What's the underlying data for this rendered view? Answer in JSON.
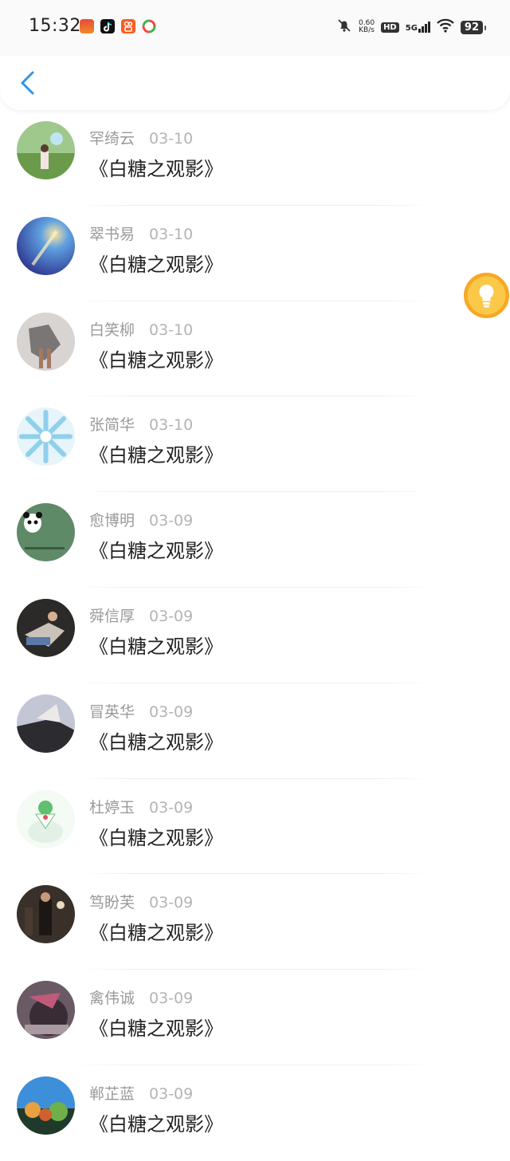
{
  "status_bar": {
    "time": "15:32",
    "net_speed_value": "0.60",
    "net_speed_unit": "KB/s",
    "hd_label": "HD",
    "network_type": "5G",
    "battery": "92",
    "icons": [
      "bell-muted-icon",
      "hd-icon",
      "signal-5g-icon",
      "wifi-icon",
      "battery-icon"
    ],
    "app_icons": [
      "sohu-video-app-icon",
      "douyin-app-icon",
      "kuaishou-app-icon",
      "pinwheel-app-icon"
    ]
  },
  "header": {
    "back_icon": "chevron-left-icon",
    "accent_color": "#2e96e8"
  },
  "list": [
    {
      "name": "罕绮云",
      "date": "03-10",
      "title": "《白糖之观影》"
    },
    {
      "name": "翠书易",
      "date": "03-10",
      "title": "《白糖之观影》"
    },
    {
      "name": "白笑柳",
      "date": "03-10",
      "title": "《白糖之观影》"
    },
    {
      "name": "张简华",
      "date": "03-10",
      "title": "《白糖之观影》"
    },
    {
      "name": "愈博明",
      "date": "03-09",
      "title": "《白糖之观影》"
    },
    {
      "name": "舜信厚",
      "date": "03-09",
      "title": "《白糖之观影》"
    },
    {
      "name": "冒英华",
      "date": "03-09",
      "title": "《白糖之观影》"
    },
    {
      "name": "杜婷玉",
      "date": "03-09",
      "title": "《白糖之观影》"
    },
    {
      "name": "笃盼芙",
      "date": "03-09",
      "title": "《白糖之观影》"
    },
    {
      "name": "禽伟诚",
      "date": "03-09",
      "title": "《白糖之观影》"
    },
    {
      "name": "郸芷蓝",
      "date": "03-09",
      "title": "《白糖之观影》"
    }
  ],
  "floating_button": {
    "icon": "lightbulb-icon",
    "color": "#f7a823"
  }
}
